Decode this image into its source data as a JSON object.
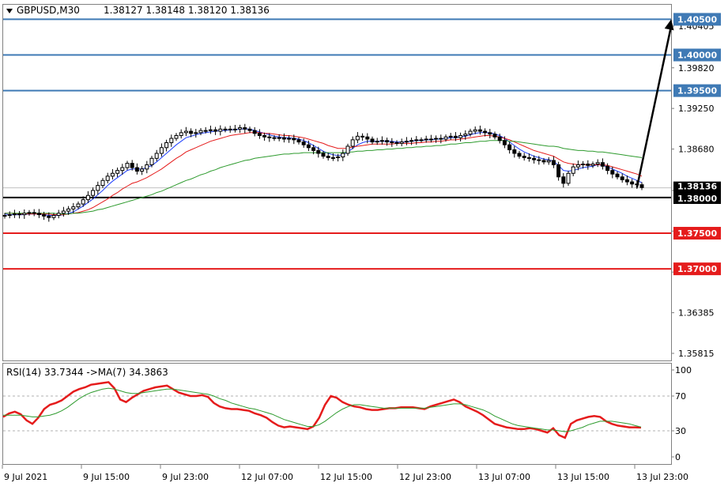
{
  "header": {
    "symbol": "GBPUSD,M30",
    "ohlc": "1.38127 1.38148 1.38120 1.38136"
  },
  "chart_data": [
    {
      "type": "candlestick",
      "title": "GBPUSD,M30",
      "price_axis": {
        "ticks": [
          1.40405,
          1.3982,
          1.3925,
          1.3868,
          1.381,
          1.3753,
          1.36955,
          1.36385,
          1.35815
        ],
        "ylim": [
          1.35815,
          1.40405
        ]
      },
      "time_axis": {
        "ticks": [
          "9 Jul 2021",
          "9 Jul 15:00",
          "9 Jul 23:00",
          "12 Jul 07:00",
          "12 Jul 15:00",
          "12 Jul 23:00",
          "13 Jul 07:00",
          "13 Jul 15:00",
          "13 Jul 23:00"
        ]
      },
      "current_price": "1.38136",
      "levels": [
        {
          "label": "1.40500",
          "value": 1.405,
          "color": "#3F7AB5"
        },
        {
          "label": "1.40000",
          "value": 1.4,
          "color": "#3F7AB5"
        },
        {
          "label": "1.39500",
          "value": 1.395,
          "color": "#3F7AB5"
        },
        {
          "label": "1.38000",
          "value": 1.38,
          "color": "#000000"
        },
        {
          "label": "1.37500",
          "value": 1.375,
          "color": "#E51C1C"
        },
        {
          "label": "1.37000",
          "value": 1.37,
          "color": "#E51C1C"
        }
      ],
      "close_path": [
        1.3775,
        1.3776,
        1.3777,
        1.3776,
        1.3778,
        1.3779,
        1.3778,
        1.3776,
        1.3774,
        1.3772,
        1.3775,
        1.3778,
        1.3781,
        1.3784,
        1.3787,
        1.3791,
        1.3797,
        1.3803,
        1.381,
        1.3817,
        1.3824,
        1.383,
        1.3834,
        1.3838,
        1.3842,
        1.3848,
        1.3842,
        1.3837,
        1.384,
        1.3846,
        1.3855,
        1.3862,
        1.387,
        1.3877,
        1.3883,
        1.3887,
        1.3891,
        1.3893,
        1.389,
        1.3891,
        1.3894,
        1.3894,
        1.3895,
        1.3893,
        1.3896,
        1.3895,
        1.3896,
        1.3896,
        1.3898,
        1.3896,
        1.3894,
        1.389,
        1.3887,
        1.3885,
        1.3884,
        1.3883,
        1.3884,
        1.3882,
        1.3883,
        1.3881,
        1.3878,
        1.3874,
        1.387,
        1.3866,
        1.3862,
        1.3858,
        1.3856,
        1.3856,
        1.3857,
        1.3862,
        1.3872,
        1.3881,
        1.3886,
        1.3885,
        1.3882,
        1.3878,
        1.3879,
        1.388,
        1.3878,
        1.3877,
        1.3876,
        1.3878,
        1.3879,
        1.388,
        1.3881,
        1.3881,
        1.3882,
        1.3882,
        1.3883,
        1.3882,
        1.3885,
        1.3886,
        1.3884,
        1.3887,
        1.3889,
        1.3893,
        1.3895,
        1.3893,
        1.3891,
        1.3889,
        1.3885,
        1.388,
        1.3874,
        1.3867,
        1.3862,
        1.3858,
        1.3856,
        1.3855,
        1.3853,
        1.3852,
        1.385,
        1.3852,
        1.3846,
        1.3829,
        1.382,
        1.3834,
        1.3843,
        1.3846,
        1.3847,
        1.3845,
        1.3847,
        1.3849,
        1.3844,
        1.3838,
        1.3833,
        1.3829,
        1.3825,
        1.3822,
        1.3819,
        1.3818,
        1.3814
      ],
      "moving_averages": [
        {
          "color": "#1F3FFF",
          "values": [
            1.3777,
            1.3776,
            1.3776,
            1.3776,
            1.3776,
            1.3777,
            1.3777,
            1.3777,
            1.3776,
            1.3775,
            1.3775,
            1.3775,
            1.3776,
            1.3778,
            1.378,
            1.3784,
            1.3788,
            1.3793,
            1.3798,
            1.3804,
            1.381,
            1.3817,
            1.3823,
            1.3828,
            1.3833,
            1.3838,
            1.384,
            1.384,
            1.384,
            1.3842,
            1.3845,
            1.385,
            1.3856,
            1.3862,
            1.3868,
            1.3874,
            1.3879,
            1.3884,
            1.3886,
            1.3888,
            1.389,
            1.3891,
            1.3892,
            1.3893,
            1.3894,
            1.3894,
            1.3895,
            1.3895,
            1.3896,
            1.3896,
            1.3896,
            1.3894,
            1.3892,
            1.389,
            1.3888,
            1.3886,
            1.3885,
            1.3884,
            1.3884,
            1.3883,
            1.3882,
            1.388,
            1.3877,
            1.3873,
            1.3869,
            1.3865,
            1.3862,
            1.386,
            1.3859,
            1.386,
            1.3864,
            1.3869,
            1.3874,
            1.3877,
            1.3879,
            1.3879,
            1.3879,
            1.3879,
            1.3879,
            1.3879,
            1.3878,
            1.3878,
            1.3878,
            1.3879,
            1.388,
            1.388,
            1.3881,
            1.3881,
            1.3882,
            1.3882,
            1.3883,
            1.3884,
            1.3884,
            1.3885,
            1.3886,
            1.3888,
            1.389,
            1.3891,
            1.3891,
            1.3891,
            1.3889,
            1.3887,
            1.3883,
            1.3878,
            1.3873,
            1.3868,
            1.3864,
            1.3861,
            1.3858,
            1.3856,
            1.3854,
            1.3853,
            1.3851,
            1.3845,
            1.3838,
            1.3837,
            1.3838,
            1.384,
            1.3842,
            1.3843,
            1.3844,
            1.3846,
            1.3845,
            1.3843,
            1.384,
            1.3837,
            1.3834,
            1.383,
            1.3827,
            1.3824,
            1.3821
          ]
        },
        {
          "color": "#E51C1C",
          "values": [
            1.3778,
            1.3778,
            1.3778,
            1.3777,
            1.3777,
            1.3777,
            1.3777,
            1.3777,
            1.3777,
            1.3777,
            1.3776,
            1.3776,
            1.3776,
            1.3777,
            1.3778,
            1.3779,
            1.3781,
            1.3783,
            1.3786,
            1.379,
            1.3794,
            1.3798,
            1.3803,
            1.3807,
            1.3812,
            1.3816,
            1.382,
            1.3822,
            1.3825,
            1.3828,
            1.3832,
            1.3836,
            1.384,
            1.3845,
            1.385,
            1.3855,
            1.3859,
            1.3864,
            1.3867,
            1.387,
            1.3873,
            1.3876,
            1.3879,
            1.3881,
            1.3883,
            1.3885,
            1.3887,
            1.3888,
            1.3889,
            1.389,
            1.3891,
            1.3891,
            1.3891,
            1.389,
            1.389,
            1.3889,
            1.3888,
            1.3887,
            1.3887,
            1.3886,
            1.3885,
            1.3884,
            1.3882,
            1.388,
            1.3878,
            1.3876,
            1.3873,
            1.3871,
            1.3869,
            1.3869,
            1.3869,
            1.3871,
            1.3872,
            1.3873,
            1.3874,
            1.3875,
            1.3875,
            1.3875,
            1.3875,
            1.3875,
            1.3876,
            1.3876,
            1.3876,
            1.3876,
            1.3877,
            1.3877,
            1.3878,
            1.3878,
            1.3879,
            1.3879,
            1.388,
            1.3881,
            1.3881,
            1.3882,
            1.3883,
            1.3884,
            1.3885,
            1.3886,
            1.3887,
            1.3887,
            1.3886,
            1.3885,
            1.3883,
            1.3881,
            1.3878,
            1.3875,
            1.3872,
            1.3869,
            1.3866,
            1.3864,
            1.3862,
            1.386,
            1.3858,
            1.3854,
            1.385,
            1.3848,
            1.3847,
            1.3846,
            1.3846,
            1.3846,
            1.3846,
            1.3846,
            1.3846,
            1.3845,
            1.3843,
            1.3841,
            1.3839,
            1.3837,
            1.3835,
            1.3833,
            1.383
          ]
        },
        {
          "color": "#2E9B2E",
          "values": [
            1.3778,
            1.3778,
            1.3778,
            1.3778,
            1.3778,
            1.3778,
            1.3778,
            1.3778,
            1.3778,
            1.3778,
            1.3778,
            1.3777,
            1.3777,
            1.3777,
            1.3778,
            1.3778,
            1.3779,
            1.378,
            1.3781,
            1.3783,
            1.3784,
            1.3786,
            1.3788,
            1.379,
            1.3792,
            1.3794,
            1.3796,
            1.3798,
            1.38,
            1.3802,
            1.3804,
            1.3807,
            1.3809,
            1.3812,
            1.3815,
            1.3818,
            1.3821,
            1.3824,
            1.3826,
            1.3829,
            1.3832,
            1.3834,
            1.3837,
            1.3839,
            1.3842,
            1.3844,
            1.3846,
            1.3848,
            1.385,
            1.3852,
            1.3853,
            1.3855,
            1.3856,
            1.3857,
            1.3858,
            1.3859,
            1.386,
            1.3861,
            1.3861,
            1.3862,
            1.3862,
            1.3863,
            1.3863,
            1.3863,
            1.3863,
            1.3863,
            1.3863,
            1.3863,
            1.3863,
            1.3863,
            1.3864,
            1.3864,
            1.3865,
            1.3865,
            1.3866,
            1.3866,
            1.3867,
            1.3867,
            1.3868,
            1.3868,
            1.3869,
            1.3869,
            1.387,
            1.387,
            1.3871,
            1.3871,
            1.3872,
            1.3872,
            1.3873,
            1.3873,
            1.3874,
            1.3875,
            1.3875,
            1.3876,
            1.3877,
            1.3877,
            1.3878,
            1.3879,
            1.3879,
            1.388,
            1.388,
            1.388,
            1.388,
            1.3879,
            1.3879,
            1.3878,
            1.3877,
            1.3876,
            1.3875,
            1.3874,
            1.3873,
            1.3872,
            1.3872,
            1.3871,
            1.3869,
            1.3868,
            1.3867,
            1.3866,
            1.3866,
            1.3865,
            1.3865,
            1.3864,
            1.3864,
            1.3863,
            1.3862,
            1.3861,
            1.386,
            1.3859,
            1.3858,
            1.3857,
            1.3856
          ]
        }
      ],
      "arrow": {
        "from": [
          129,
          1.3814
        ],
        "to": [
          136,
          1.405
        ]
      }
    },
    {
      "type": "line",
      "title": "RSI(14) 33.7344  ->MA(7) 34.3863",
      "ylim": [
        0,
        100
      ],
      "yticks": [
        100,
        70,
        30,
        0
      ],
      "levels": [
        70,
        30
      ],
      "series": [
        {
          "name": "RSI(14)",
          "color": "#E51C1C",
          "values": [
            46,
            50,
            52,
            49,
            42,
            38,
            45,
            55,
            60,
            62,
            65,
            70,
            75,
            78,
            80,
            83,
            84,
            85,
            86,
            79,
            66,
            63,
            68,
            72,
            76,
            78,
            80,
            81,
            82,
            78,
            74,
            72,
            70,
            70,
            71,
            69,
            62,
            58,
            56,
            55,
            55,
            54,
            53,
            50,
            48,
            45,
            40,
            36,
            34,
            35,
            34,
            33,
            32,
            35,
            45,
            60,
            70,
            68,
            63,
            60,
            58,
            57,
            55,
            54,
            54,
            55,
            56,
            56,
            57,
            57,
            57,
            56,
            55,
            58,
            60,
            62,
            64,
            66,
            63,
            58,
            55,
            52,
            48,
            43,
            38,
            36,
            34,
            33,
            32,
            32,
            33,
            32,
            30,
            28,
            33,
            25,
            22,
            38,
            42,
            44,
            46,
            47,
            46,
            41,
            38,
            36,
            35,
            34,
            34,
            33.7
          ]
        },
        {
          "name": "MA(7)",
          "color": "#2E9B2E",
          "values": [
            48,
            48,
            48,
            48,
            47,
            46,
            46,
            47,
            48,
            50,
            53,
            57,
            62,
            67,
            71,
            74,
            76,
            78,
            79,
            78,
            76,
            74,
            73,
            73,
            74,
            75,
            76,
            77,
            78,
            78,
            77,
            76,
            75,
            74,
            73,
            72,
            70,
            67,
            65,
            62,
            60,
            58,
            56,
            55,
            53,
            51,
            49,
            46,
            43,
            41,
            39,
            37,
            35,
            35,
            37,
            41,
            46,
            51,
            55,
            58,
            60,
            60,
            59,
            58,
            57,
            56,
            56,
            56,
            56,
            56,
            56,
            56,
            56,
            57,
            58,
            59,
            60,
            61,
            61,
            60,
            58,
            56,
            54,
            51,
            47,
            44,
            41,
            38,
            36,
            35,
            34,
            33,
            32,
            31,
            31,
            30,
            29,
            30,
            32,
            34,
            37,
            39,
            41,
            41,
            41,
            40,
            39,
            38,
            36,
            34.4
          ]
        }
      ]
    }
  ],
  "rsi": {
    "label": "RSI(14) 33.7344  ->MA(7) 34.3863",
    "yticks": [
      "100",
      "70",
      "30",
      "0"
    ]
  },
  "colors": {
    "bull_candle": "#ffffff",
    "bear_candle": "#000000",
    "blue_level": "#3F7AB5",
    "red_level": "#E51C1C",
    "grid": "#c0c0c0"
  }
}
